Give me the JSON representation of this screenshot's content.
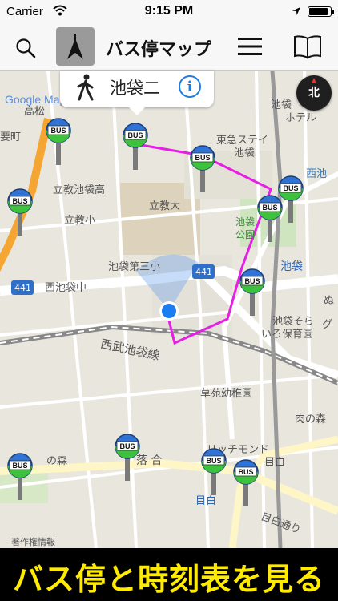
{
  "status_bar": {
    "carrier": "Carrier",
    "time": "9:15 PM",
    "battery_level": 0.95
  },
  "nav_bar": {
    "title": "バス停マップ",
    "search_icon": "search-icon",
    "location_mode_icon": "compass-arrow-icon",
    "menu_icon": "hamburger-menu-icon",
    "book_icon": "book-icon"
  },
  "callout": {
    "title": "池袋二",
    "info_icon": "info-icon",
    "walk_icon": "walking-person-icon"
  },
  "compass": {
    "label": "北"
  },
  "map": {
    "google_logo": "Google Map",
    "copyright": "著作権情報",
    "labels": {
      "tokyu": "東急ステイ",
      "ikebukuro": "池袋",
      "hotel": "ホテル",
      "ikebukuro_hotel": "池袋",
      "nishiikebukuro": "西池袋",
      "rikkyo_high": "立教池袋高",
      "rikkyo_univ": "立教大",
      "rikkyo_elem": "立教小",
      "ikebukuro_3": "池袋第三小",
      "route441a": "441",
      "route441b": "441",
      "nishiikebukuro_naka": "西池袋中",
      "ikebukuro_park": "池袋",
      "park": "公園",
      "ikebukuro_station": "池袋",
      "ikebukuro_sora": "池袋そら",
      "iroha": "いろ保育園",
      "seibu_line": "西武池袋線",
      "soen": "草苑幼稚園",
      "richmond": "リッチモンド",
      "mejiro_kanji": "目白",
      "mejiro": "目白",
      "mejiro_dori": "目白通り",
      "ochiai": "落 合",
      "no_mori": "の森",
      "nishiike_right": "西池",
      "nu": "ぬ",
      "gu": "グ",
      "nikunomori": "肉の森",
      "honmachi": "要町",
      "takamatsu": "高松"
    },
    "bus_stop_label": "BUS",
    "route_color": "#e61ee6"
  },
  "banner": {
    "text": "バス停と時刻表を見る"
  }
}
